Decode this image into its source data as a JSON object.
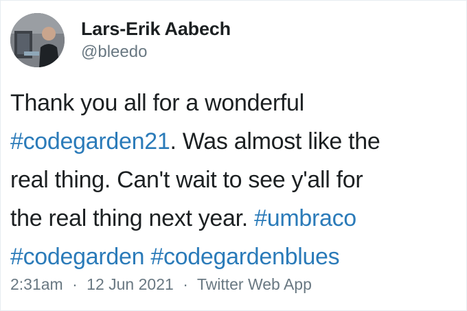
{
  "author": {
    "display_name": "Lars-Erik Aabech",
    "handle": "@bleedo",
    "avatar_icon": "avatar-photo-icon"
  },
  "tweet": {
    "lines": [
      [
        {
          "text": "Thank you all for a wonderful",
          "type": "text"
        }
      ],
      [
        {
          "text": "#codegarden21",
          "type": "hashtag"
        },
        {
          "text": ". Was almost like the",
          "type": "text"
        }
      ],
      [
        {
          "text": "real thing. Can't wait to see y'all for",
          "type": "text"
        }
      ],
      [
        {
          "text": "the real thing next year. ",
          "type": "text"
        },
        {
          "text": "#umbraco",
          "type": "hashtag"
        }
      ],
      [
        {
          "text": "#codegarden",
          "type": "hashtag"
        },
        {
          "text": " ",
          "type": "text"
        },
        {
          "text": "#codegardenblues",
          "type": "hashtag"
        }
      ]
    ]
  },
  "meta": {
    "time": "2:31am",
    "separator": "·",
    "date": "12 Jun 2021",
    "source": "Twitter Web App"
  },
  "colors": {
    "text": "#1c2022",
    "secondary": "#697882",
    "link": "#2b7bb9"
  }
}
